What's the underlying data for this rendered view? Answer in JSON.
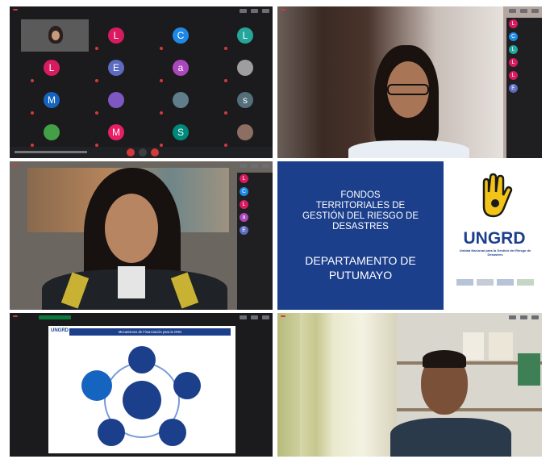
{
  "recording_label": "",
  "panel1": {
    "tiles": [
      {
        "letter": "L",
        "color": "#d81b60"
      },
      {
        "letter": "C",
        "color": "#1e88e5"
      },
      {
        "letter": "L",
        "color": "#26a69a"
      },
      {
        "letter": "L",
        "color": "#d81b60"
      },
      {
        "letter": "E",
        "color": "#5c6bc0"
      },
      {
        "letter": "a",
        "color": "#ab47bc"
      },
      {
        "letter": "",
        "color": "#9e9e9e"
      },
      {
        "letter": "M",
        "color": "#1565c0"
      },
      {
        "letter": "",
        "color": "#7e57c2"
      },
      {
        "letter": "",
        "color": "#607d8b"
      },
      {
        "letter": "s",
        "color": "#546e7a"
      },
      {
        "letter": "",
        "color": "#43a047"
      },
      {
        "letter": "M",
        "color": "#e91e63"
      },
      {
        "letter": "S",
        "color": "#00897b"
      },
      {
        "letter": "",
        "color": "#8d6e63"
      }
    ]
  },
  "panel2": {
    "side": [
      {
        "letter": "L",
        "color": "#d81b60"
      },
      {
        "letter": "C",
        "color": "#1e88e5"
      },
      {
        "letter": "L",
        "color": "#26a69a"
      },
      {
        "letter": "L",
        "color": "#d81b60"
      },
      {
        "letter": "L",
        "color": "#d81b60"
      },
      {
        "letter": "E",
        "color": "#5c6bc0"
      }
    ]
  },
  "panel3": {
    "side": [
      {
        "letter": "L",
        "color": "#d81b60"
      },
      {
        "letter": "C",
        "color": "#1e88e5"
      },
      {
        "letter": "L",
        "color": "#d81b60"
      },
      {
        "letter": "a",
        "color": "#ab47bc"
      },
      {
        "letter": "E",
        "color": "#5c6bc0"
      }
    ]
  },
  "slide": {
    "title_lines": [
      "FONDOS",
      "TERRITORIALES DE",
      "GESTIÓN DEL RIESGO DE",
      "DESASTRES"
    ],
    "subtitle_lines": [
      "DEPARTAMENTO DE",
      "PUTUMAYO"
    ],
    "logo_text": "UNGRD",
    "logo_caption": "Unidad Nacional para la Gestión del Riesgo de Desastres"
  },
  "diagram": {
    "header": "Mecanismos de Financiación para la GRD",
    "logo": "UNGRD",
    "center": "",
    "nodes": [
      "",
      "",
      "",
      "",
      ""
    ]
  },
  "colors": {
    "dark": "#1b1b1d",
    "slide_blue": "#1c3f8c",
    "accent_yellow": "#f2c418",
    "red": "#d23a3a"
  }
}
